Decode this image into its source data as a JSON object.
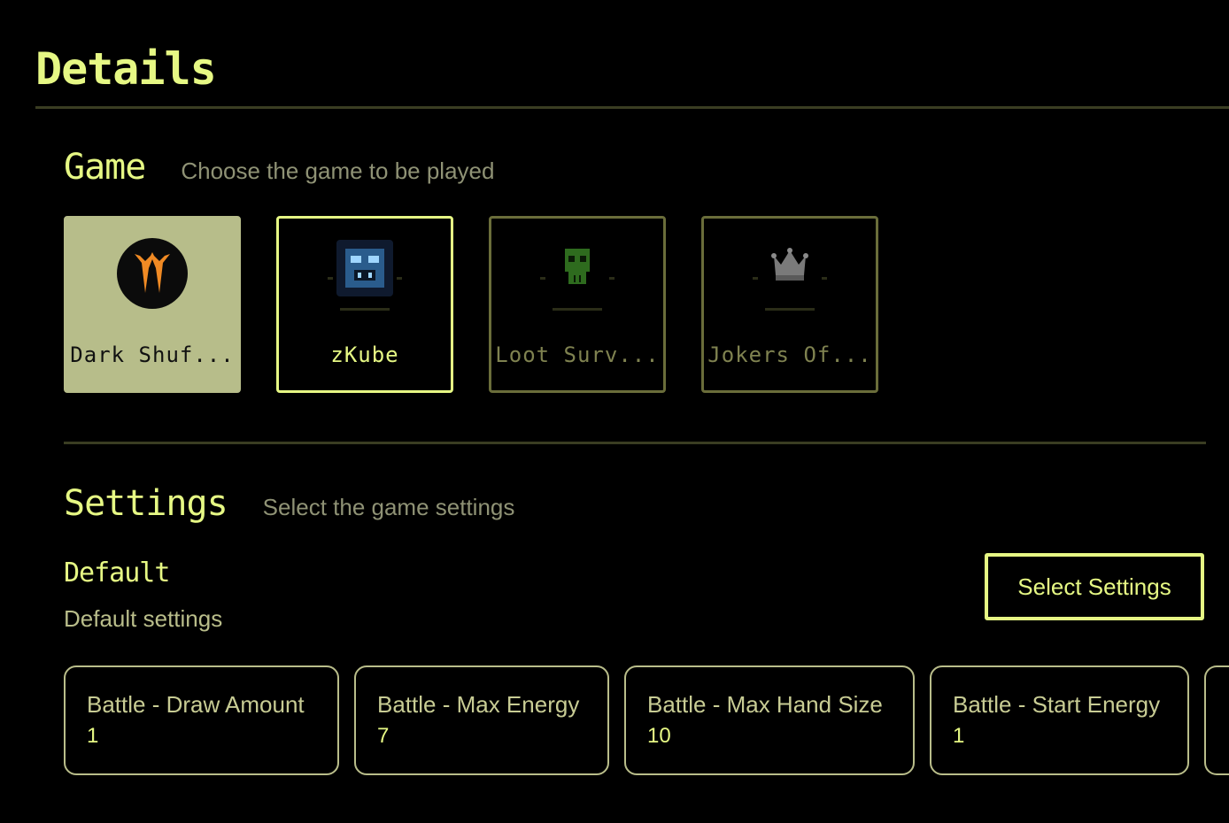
{
  "page": {
    "title": "Details"
  },
  "game_section": {
    "title": "Game",
    "subtitle": "Choose the game to be played",
    "games": [
      {
        "label": "Dark Shuf...",
        "icon": "dark-shuffle-logo-icon",
        "state": "selected"
      },
      {
        "label": "zKube",
        "icon": "zkube-totem-icon",
        "state": "focused"
      },
      {
        "label": "Loot Surv...",
        "icon": "loot-survivor-skull-icon",
        "state": "dim"
      },
      {
        "label": "Jokers Of...",
        "icon": "jokers-crown-icon",
        "state": "dim"
      }
    ]
  },
  "settings_section": {
    "title": "Settings",
    "subtitle": "Select the game settings",
    "preset_name": "Default",
    "preset_description": "Default settings",
    "select_button": "Select Settings",
    "items": [
      {
        "name": "Battle - Draw Amount",
        "value": "1"
      },
      {
        "name": "Battle - Max Energy",
        "value": "7"
      },
      {
        "name": "Battle - Max Hand Size",
        "value": "10"
      },
      {
        "name": "Battle - Start Energy",
        "value": "1"
      }
    ]
  },
  "colors": {
    "accent": "#e6f884",
    "background": "#000000",
    "selected_card": "#b7bd8a",
    "muted_text": "#8f9275"
  }
}
